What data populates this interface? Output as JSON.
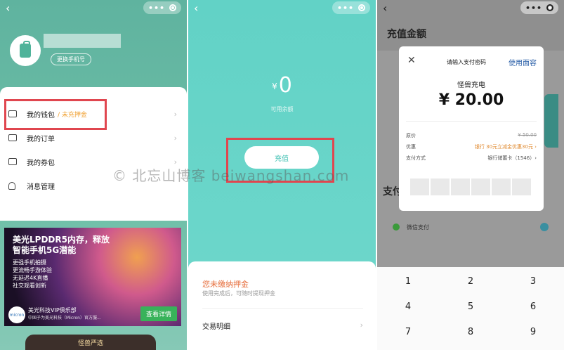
{
  "panel1": {
    "change_phone": "更换手机号",
    "menu": [
      {
        "label": "我的钱包",
        "sub": "/ 未充押金"
      },
      {
        "label": "我的订单"
      },
      {
        "label": "我的券包"
      },
      {
        "label": "消息管理"
      }
    ],
    "ad": {
      "title": "美光LPDDR5内存，释放智能手机5G潜能",
      "lines": [
        "更强手机拍摄",
        "更流畅手游体验",
        "无延迟4K直播",
        "社交观看创新"
      ],
      "logo": "micron",
      "brand": "美光科技VIP俱乐部",
      "brand_sub": "中国子为美光科技（Micron）官方服...",
      "cta": "查看详情"
    },
    "bottom_banner": "怪兽严选"
  },
  "panel2": {
    "currency": "¥",
    "balance": "0",
    "balance_label": "可用余额",
    "recharge": "充值",
    "deposit_title": "您未缴纳押金",
    "deposit_sub": "使用完成后，可随时提现押金",
    "trade_detail": "交易明细"
  },
  "panel3": {
    "page_title": "充值金额",
    "pay_heading": "支付",
    "wechat_pay": "微信支付",
    "dialog": {
      "title": "请输入支付密码",
      "face": "使用面容",
      "merchant": "怪兽充电",
      "amount": "¥ 20.00",
      "rows": [
        {
          "label": "原价",
          "value": "¥ 50.00"
        },
        {
          "label": "优惠",
          "value": "银行 30元立减金优惠30元 ›"
        },
        {
          "label": "支付方式",
          "value": "银行储蓄卡（1546）›"
        }
      ]
    },
    "keys": [
      "1",
      "2",
      "3",
      "4",
      "5",
      "6",
      "7",
      "8",
      "9"
    ]
  },
  "watermark": "© 北忘山博客 beiwangshan.com",
  "colors": {
    "highlight": "#e0464f",
    "teal": "#62d2c6",
    "green": "#5fb39f"
  }
}
